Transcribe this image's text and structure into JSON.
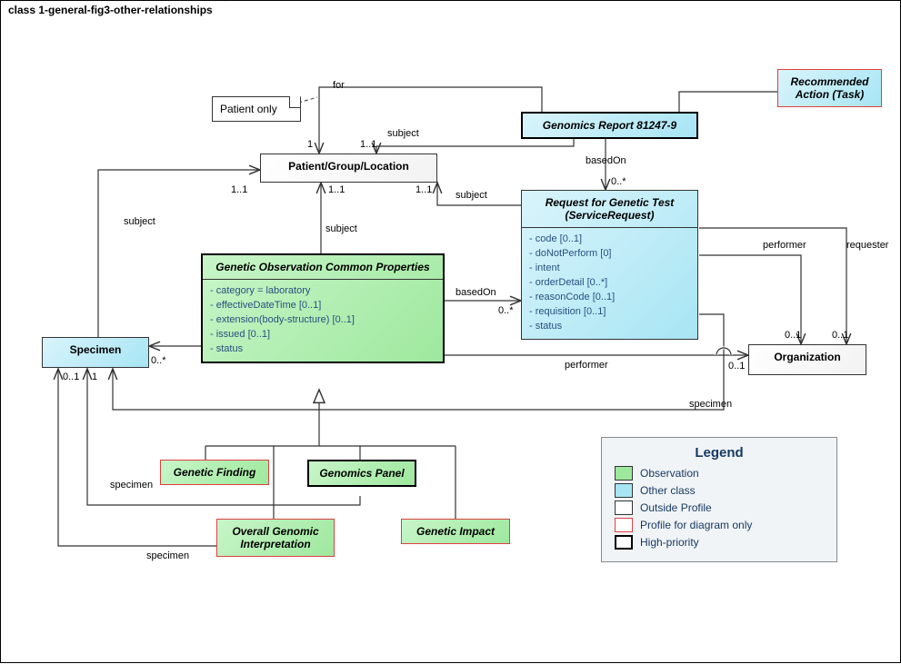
{
  "frame_title": "class 1-general-fig3-other-relationships",
  "patient_only_note": "Patient only",
  "boxes": {
    "genomics_report": "Genomics Report 81247-9",
    "recommended_action": "Recommended Action (Task)",
    "pgl": "Patient/Group/Location",
    "service_request": {
      "title": "Request for Genetic Test (ServiceRequest)",
      "attrs": [
        "code [0..1]",
        "doNotPerform [0]",
        "intent",
        "orderDetail [0..*]",
        "reasonCode [0..1]",
        "requisition [0..1]",
        "status"
      ]
    },
    "gocp": {
      "title": "Genetic Observation Common Properties",
      "attrs": [
        "category = laboratory",
        "effectiveDateTime [0..1]",
        "extension(body-structure) [0..1]",
        "issued [0..1]",
        "status"
      ]
    },
    "specimen": "Specimen",
    "organization": "Organization",
    "genetic_finding": "Genetic Finding",
    "genomics_panel": "Genomics Panel",
    "overall_interpretation": "Overall Genomic Interpretation",
    "genetic_impact": "Genetic Impact"
  },
  "labels": {
    "for": "for",
    "subject": "subject",
    "basedOn": "basedOn",
    "performer": "performer",
    "requester": "requester",
    "specimen": "specimen",
    "m_1": "1",
    "m_1_1": "1..1",
    "m_0_1": "0..1",
    "m_0_s": "0..*"
  },
  "legend": {
    "title": "Legend",
    "rows": [
      "Observation",
      "Other class",
      "Outside Profile",
      "Profile for diagram only",
      "High-priority"
    ]
  }
}
